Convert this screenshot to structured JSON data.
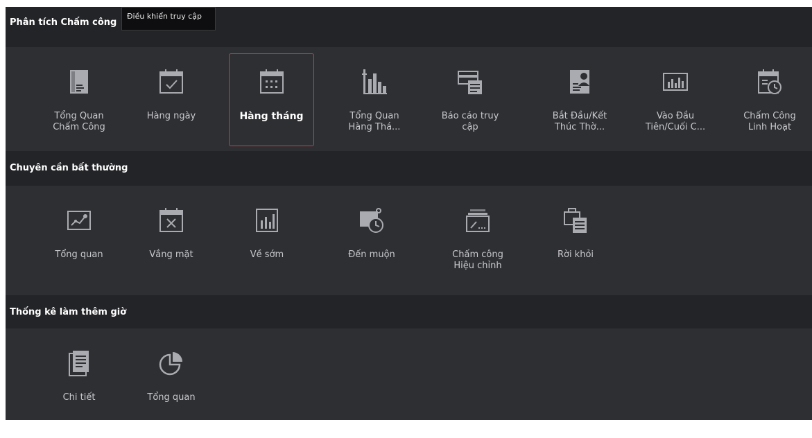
{
  "tooltip": "Điều khiển truy cập",
  "sections": [
    {
      "title": "Phân tích Chấm công",
      "items": [
        {
          "label": "Tổng Quan\nChấm Công",
          "icon": "overview-report-icon"
        },
        {
          "label": "Hàng ngày",
          "icon": "calendar-check-icon"
        },
        {
          "label": "Hàng tháng",
          "icon": "calendar-grid-icon",
          "selected": true
        },
        {
          "label": "Tổng Quan\nHàng Thá...",
          "icon": "bar-chart-icon"
        },
        {
          "label": "Báo cáo truy\ncập",
          "icon": "access-card-icon"
        },
        {
          "label": "Bắt Đầu/Kết\nThúc Thờ...",
          "icon": "person-card-icon"
        },
        {
          "label": "Vào Đầu\nTiên/Cuối C...",
          "icon": "monitor-chart-icon"
        },
        {
          "label": "Chấm Công\nLinh Hoạt",
          "icon": "calendar-clock-icon"
        }
      ]
    },
    {
      "title": "Chuyên cần bất thường",
      "items": [
        {
          "label": "Tổng quan",
          "icon": "trend-line-icon"
        },
        {
          "label": "Vắng mặt",
          "icon": "calendar-x-icon"
        },
        {
          "label": "Về sớm",
          "icon": "chart-panel-icon"
        },
        {
          "label": "Đến muộn",
          "icon": "late-clock-icon"
        },
        {
          "label": "Chấm công\nHiệu chỉnh",
          "icon": "edit-tray-icon"
        },
        {
          "label": "Rời khỏi",
          "icon": "briefcase-icon"
        }
      ]
    },
    {
      "title": "Thống kê làm thêm giờ",
      "items": [
        {
          "label": "Chi tiết",
          "icon": "document-list-icon"
        },
        {
          "label": "Tổng quan",
          "icon": "pie-chart-icon"
        }
      ]
    }
  ],
  "colors": {
    "background": "#232427",
    "panel": "#2e2f33",
    "accent": "#d63a3a",
    "icon": "#a9abb0"
  }
}
